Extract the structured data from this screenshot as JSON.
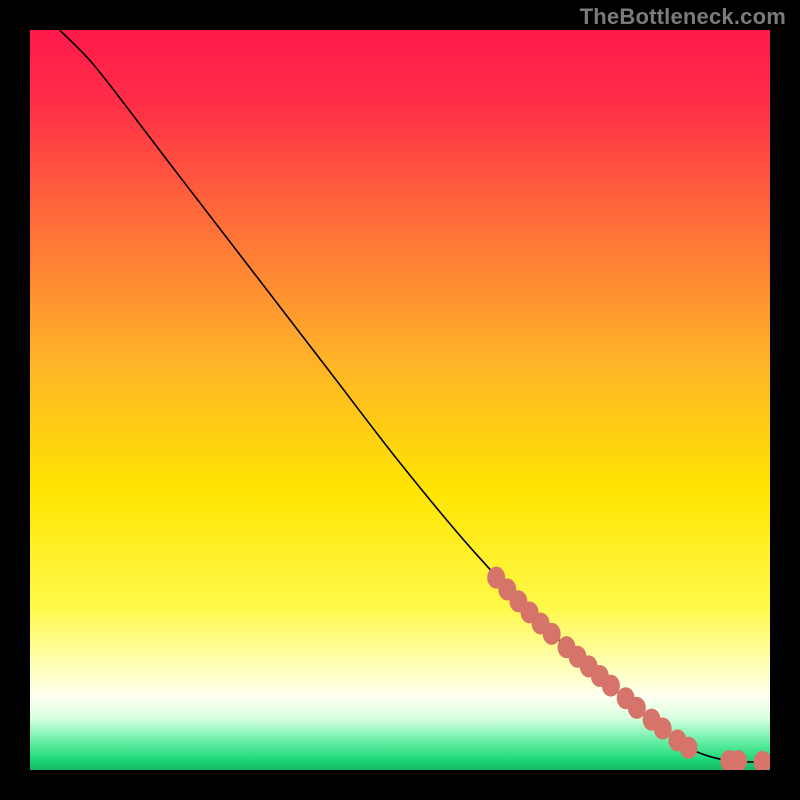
{
  "watermark": "TheBottleneck.com",
  "chart_data": {
    "type": "line",
    "title": "",
    "xlabel": "",
    "ylabel": "",
    "xlim": [
      0,
      100
    ],
    "ylim": [
      0,
      100
    ],
    "grid": false,
    "legend": false,
    "curve": [
      {
        "x": 4,
        "y": 100
      },
      {
        "x": 8,
        "y": 96
      },
      {
        "x": 12,
        "y": 91
      },
      {
        "x": 20,
        "y": 80.5
      },
      {
        "x": 30,
        "y": 67.5
      },
      {
        "x": 40,
        "y": 54.5
      },
      {
        "x": 50,
        "y": 41.5
      },
      {
        "x": 60,
        "y": 29.5
      },
      {
        "x": 70,
        "y": 19
      },
      {
        "x": 80,
        "y": 10
      },
      {
        "x": 86,
        "y": 5
      },
      {
        "x": 90,
        "y": 2.5
      },
      {
        "x": 94,
        "y": 1.3
      },
      {
        "x": 96.5,
        "y": 1.1
      },
      {
        "x": 99,
        "y": 1.1
      }
    ],
    "markers": [
      {
        "x": 63.0,
        "y": 26.0
      },
      {
        "x": 64.5,
        "y": 24.4
      },
      {
        "x": 66.0,
        "y": 22.8
      },
      {
        "x": 67.5,
        "y": 21.3
      },
      {
        "x": 69.0,
        "y": 19.8
      },
      {
        "x": 70.5,
        "y": 18.4
      },
      {
        "x": 72.5,
        "y": 16.6
      },
      {
        "x": 74.0,
        "y": 15.3
      },
      {
        "x": 75.5,
        "y": 14.0
      },
      {
        "x": 77.0,
        "y": 12.7
      },
      {
        "x": 78.5,
        "y": 11.4
      },
      {
        "x": 80.5,
        "y": 9.7
      },
      {
        "x": 82.0,
        "y": 8.4
      },
      {
        "x": 84.0,
        "y": 6.8
      },
      {
        "x": 85.5,
        "y": 5.6
      },
      {
        "x": 87.5,
        "y": 4.0
      },
      {
        "x": 89.0,
        "y": 3.0
      },
      {
        "x": 94.5,
        "y": 1.2
      },
      {
        "x": 95.7,
        "y": 1.2
      },
      {
        "x": 99.0,
        "y": 1.1
      }
    ],
    "colors": {
      "line": "#000000",
      "marker": "#d6746a",
      "gradient_top": "#ff1a4b",
      "gradient_mid1": "#ff8a2a",
      "gradient_mid2": "#ffe600",
      "gradient_pale": "#ffffcc",
      "gradient_green": "#1fd97a"
    }
  }
}
